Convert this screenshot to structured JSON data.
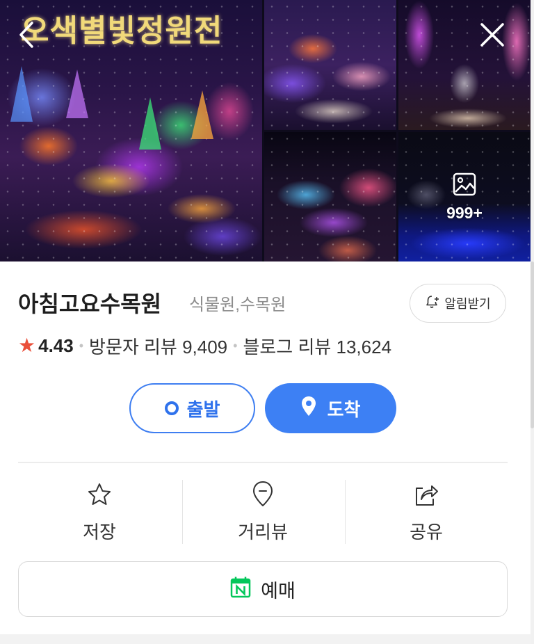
{
  "gallery": {
    "main_overlay_text": "오색별빛정원전",
    "more_count": "999+"
  },
  "place": {
    "name": "아침고요수목원",
    "category": "식물원,수목원",
    "alarm_label": "알림받기"
  },
  "rating": {
    "score": "4.43",
    "visitor_reviews": "방문자 리뷰 9,409",
    "blog_reviews": "블로그 리뷰 13,624"
  },
  "route": {
    "depart_label": "출발",
    "arrive_label": "도착"
  },
  "actions": {
    "save_label": "저장",
    "streetview_label": "거리뷰",
    "share_label": "공유"
  },
  "reserve": {
    "label": "예매"
  },
  "colors": {
    "accent": "#3d80f4",
    "star": "#ea4f3a",
    "naver_green": "#03c75a"
  }
}
